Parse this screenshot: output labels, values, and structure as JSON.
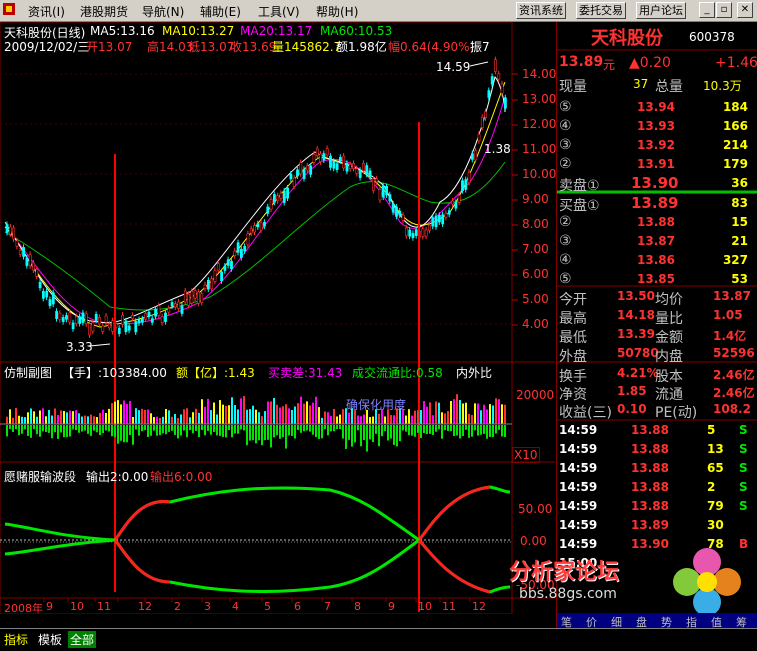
{
  "menu": {
    "items": [
      "资讯(I)",
      "港股期货",
      "导航(N)",
      "辅助(E)",
      "工具(V)",
      "帮助(H)"
    ],
    "buttons": [
      "资讯系统",
      "委托交易",
      "用户论坛"
    ]
  },
  "header": {
    "title": "天科股份(日线)",
    "ma5": "MA5:13.16",
    "ma10": "MA10:13.27",
    "ma20": "MA20:13.17",
    "ma60": "MA60:10.53",
    "info_date": "2009/12/02/三",
    "info_open": "开13.07",
    "info_high": "高14.03",
    "info_low": "低13.07",
    "info_close": "收13.69",
    "info_vol": "量145862.7",
    "info_amt": "额1.98亿",
    "info_chg": "幅0.64(4.90%)",
    "info_amp": "振7"
  },
  "price_axis": [
    "14.00",
    "13.00",
    "12.00",
    "11.00",
    "10.00",
    "9.00",
    "8.00",
    "7.00",
    "6.00",
    "5.00",
    "4.00"
  ],
  "price_labels": {
    "high": "14.59",
    "low": "3.33",
    "right_mark": "1.38"
  },
  "volume_header": {
    "title": "仿制副图",
    "hand": "【手】:103384.00",
    "yi": "额【亿】:1.43",
    "diff": "买卖差:31.43",
    "ratio": "成交流通比:0.58",
    "inout": "内外比",
    "axis": "20000",
    "x10": "X10",
    "overlay": "确保化用度"
  },
  "indicator": {
    "title": "愿赌服输波段",
    "out1": "输出2:0.00",
    "out2": "输出6:0.00",
    "axis": [
      "50.00",
      "0.00",
      "-50.00"
    ]
  },
  "date_axis": [
    "2008年",
    "9",
    "10",
    "11",
    "12",
    "2",
    "3",
    "4",
    "5",
    "6",
    "7",
    "8",
    "9",
    "10",
    "11",
    "12"
  ],
  "bottom_tabs": [
    "指标",
    "模板",
    "全部"
  ],
  "stock": {
    "name": "天科股份",
    "code": "600378",
    "price": "13.89",
    "unit": "元",
    "change": "▲0.20",
    "change2": "+1.46",
    "cur_vol_label": "现量",
    "cur_vol": "37",
    "total_label": "总量",
    "total": "10.3万"
  },
  "asks": [
    {
      "lv": "⑤",
      "p": "13.94",
      "v": "184"
    },
    {
      "lv": "④",
      "p": "13.93",
      "v": "166"
    },
    {
      "lv": "③",
      "p": "13.92",
      "v": "214"
    },
    {
      "lv": "②",
      "p": "13.91",
      "v": "179"
    },
    {
      "lv": "卖盘①",
      "p": "13.90",
      "v": "36"
    }
  ],
  "bids": [
    {
      "lv": "买盘①",
      "p": "13.89",
      "v": "83"
    },
    {
      "lv": "②",
      "p": "13.88",
      "v": "15"
    },
    {
      "lv": "③",
      "p": "13.87",
      "v": "21"
    },
    {
      "lv": "④",
      "p": "13.86",
      "v": "327"
    },
    {
      "lv": "⑤",
      "p": "13.85",
      "v": "53"
    }
  ],
  "stats": [
    {
      "l1": "今开",
      "v1": "13.50",
      "l2": "均价",
      "v2": "13.87"
    },
    {
      "l1": "最高",
      "v1": "14.18",
      "l2": "量比",
      "v2": "1.05"
    },
    {
      "l1": "最低",
      "v1": "13.39",
      "l2": "金额",
      "v2": "1.4亿"
    },
    {
      "l1": "外盘",
      "v1": "50780",
      "l2": "内盘",
      "v2": "52596"
    }
  ],
  "stats2": [
    {
      "l1": "换手",
      "v1": "4.21%",
      "l2": "股本",
      "v2": "2.46亿"
    },
    {
      "l1": "净资",
      "v1": "1.85",
      "l2": "流通",
      "v2": "2.46亿"
    },
    {
      "l1": "收益(三)",
      "v1": "0.10",
      "l2": "PE(动)",
      "v2": "108.2"
    }
  ],
  "ticks": [
    {
      "t": "14:59",
      "p": "13.88",
      "v": "5",
      "s": "S"
    },
    {
      "t": "14:59",
      "p": "13.88",
      "v": "13",
      "s": "S"
    },
    {
      "t": "14:59",
      "p": "13.88",
      "v": "65",
      "s": "S"
    },
    {
      "t": "14:59",
      "p": "13.88",
      "v": "2",
      "s": "S"
    },
    {
      "t": "14:59",
      "p": "13.88",
      "v": "79",
      "s": "S"
    },
    {
      "t": "14:59",
      "p": "13.89",
      "v": "30",
      "s": ""
    },
    {
      "t": "14:59",
      "p": "13.90",
      "v": "78",
      "s": "B"
    },
    {
      "t": "15:00",
      "p": "",
      "v": "",
      "s": ""
    }
  ],
  "panel_tabs": [
    "笔",
    "价",
    "细",
    "盘",
    "势",
    "指",
    "值",
    "筹"
  ],
  "watermark": {
    "title": "分析家论坛",
    "url": "bbs.88gs.com"
  }
}
